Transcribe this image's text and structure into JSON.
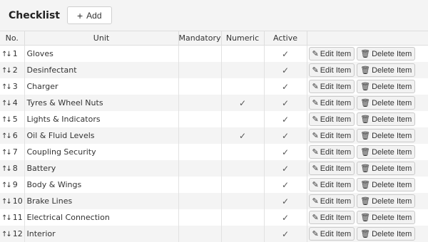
{
  "header": {
    "title": "Checklist",
    "add_label": "Add",
    "add_icon": "plus-icon"
  },
  "columns": [
    "No.",
    "Unit",
    "Mandatory",
    "Numeric",
    "Active",
    ""
  ],
  "actions": {
    "edit_label": "Edit Item",
    "delete_label": "Delete Item",
    "edit_icon": "pencil-icon",
    "delete_icon": "trash-icon"
  },
  "check_glyph": "✓",
  "rows": [
    {
      "no": "1",
      "unit": "Gloves",
      "mandatory": "",
      "numeric": "",
      "active": "✓"
    },
    {
      "no": "2",
      "unit": "Desinfectant",
      "mandatory": "",
      "numeric": "",
      "active": "✓"
    },
    {
      "no": "3",
      "unit": "Charger",
      "mandatory": "",
      "numeric": "",
      "active": "✓"
    },
    {
      "no": "4",
      "unit": "Tyres & Wheel Nuts",
      "mandatory": "",
      "numeric": "✓",
      "active": "✓"
    },
    {
      "no": "5",
      "unit": "Lights & Indicators",
      "mandatory": "",
      "numeric": "",
      "active": "✓"
    },
    {
      "no": "6",
      "unit": "Oil & Fluid Levels",
      "mandatory": "",
      "numeric": "✓",
      "active": "✓"
    },
    {
      "no": "7",
      "unit": "Coupling Security",
      "mandatory": "",
      "numeric": "",
      "active": "✓"
    },
    {
      "no": "8",
      "unit": "Battery",
      "mandatory": "",
      "numeric": "",
      "active": "✓"
    },
    {
      "no": "9",
      "unit": "Body & Wings",
      "mandatory": "",
      "numeric": "",
      "active": "✓"
    },
    {
      "no": "10",
      "unit": "Brake Lines",
      "mandatory": "",
      "numeric": "",
      "active": "✓"
    },
    {
      "no": "11",
      "unit": "Electrical Connection",
      "mandatory": "",
      "numeric": "",
      "active": "✓"
    },
    {
      "no": "12",
      "unit": "Interior",
      "mandatory": "",
      "numeric": "",
      "active": "✓"
    }
  ]
}
